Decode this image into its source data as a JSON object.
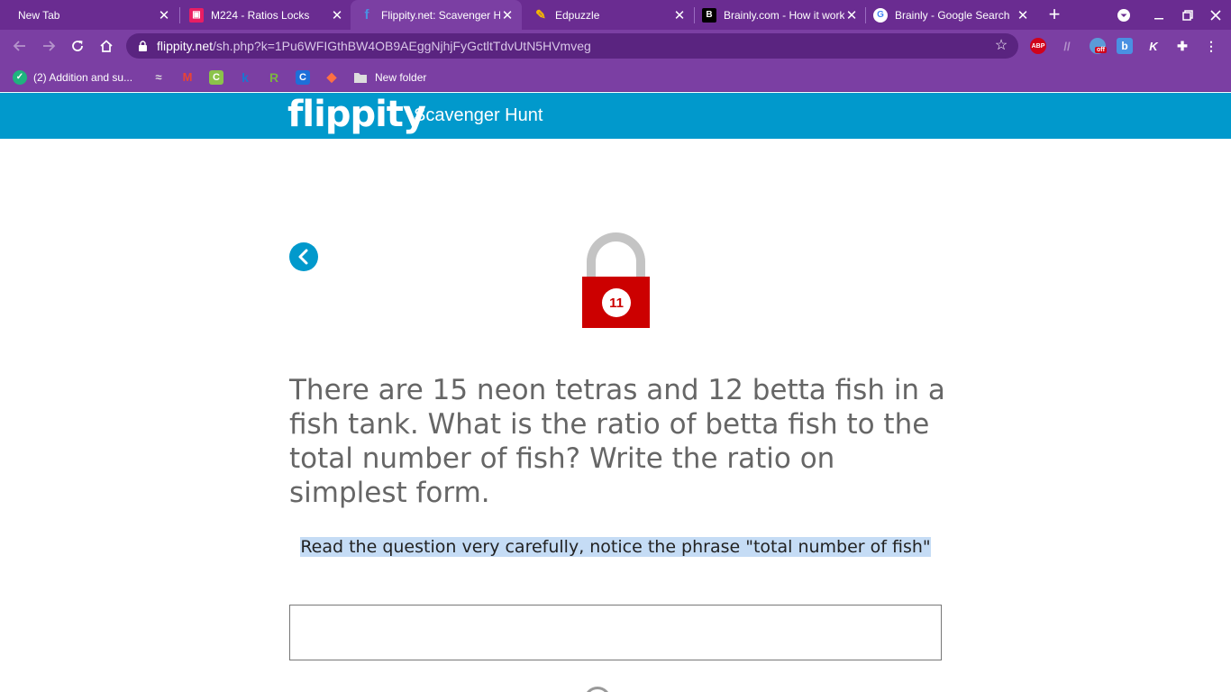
{
  "browser": {
    "tabs": [
      {
        "label": "New Tab"
      },
      {
        "label": "M224 - Ratios Locks"
      },
      {
        "label": "Flippity.net: Scavenger Hunt"
      },
      {
        "label": "Edpuzzle"
      },
      {
        "label": "Brainly.com - How it works"
      },
      {
        "label": "Brainly - Google Search"
      }
    ],
    "url_host": "flippity.net",
    "url_path": "/sh.php?k=1Pu6WFIGthBW4OB9AEggNjhjFyGctltTdvUtN5HVmveg",
    "extensions": [
      {
        "name": "adblock-plus-icon",
        "text": "ABP"
      },
      {
        "name": "off-extension-icon",
        "text": "off"
      }
    ],
    "bookmarks": [
      {
        "label": "(2) Addition and su..."
      },
      {
        "label": "New folder"
      }
    ]
  },
  "site": {
    "logo": "flippity",
    "title": "Scavenger Hunt"
  },
  "lock": {
    "number": "11"
  },
  "question": "There are 15 neon tetras and 12 betta fish in a fish tank. What is the ratio of betta fish to the total number of fish? Write the ratio on simplest form.",
  "hint": "Read the question very carefully, notice the phrase \"total number of fish\"",
  "answer": {
    "value": "",
    "placeholder": ""
  },
  "colors": {
    "browser_frame": "#7b3fa3",
    "site_header": "#0199cc",
    "lock_body": "#cc0000",
    "lock_shackle": "#c4c4c4",
    "question_text": "#666666",
    "hint_highlight": "#c5dcf5"
  }
}
